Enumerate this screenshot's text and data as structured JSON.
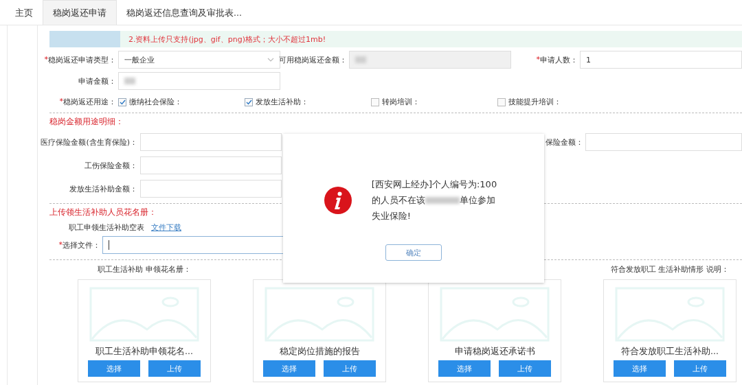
{
  "tabs": [
    {
      "label": "主页",
      "selected": false
    },
    {
      "label": "稳岗返还申请",
      "selected": true
    },
    {
      "label": "稳岗返还信息查询及审批表...",
      "selected": false
    }
  ],
  "notice": "2.资料上传只支持(jpg、gif、png)格式；大小不超过1mb!",
  "application": {
    "type": {
      "mark": "*",
      "label": "稳岗返还申请类型：",
      "value": "一般企业"
    },
    "available": {
      "label": "可用稳岗返还金额：",
      "redacted": true
    },
    "people": {
      "mark": "*",
      "label": "申请人数：",
      "value": "1"
    },
    "amount": {
      "label": "申请金额：",
      "redacted": true
    },
    "purpose": {
      "mark": "*",
      "label": "稳岗返还用途："
    },
    "purposes": [
      {
        "label": "缴纳社会保险：",
        "checked": true
      },
      {
        "label": "发放生活补助：",
        "checked": true
      },
      {
        "label": "转岗培训：",
        "checked": false
      },
      {
        "label": "技能提升培训：",
        "checked": false
      }
    ]
  },
  "detail": {
    "title": "稳岗金额用途明细：",
    "rows": [
      {
        "label": "医疗保险金额(含生育保险)：",
        "right_label": "保险金额："
      },
      {
        "label": "工伤保险金额："
      },
      {
        "label": "发放生活补助金额："
      }
    ]
  },
  "upload": {
    "title": "上传领生活补助人员花名册：",
    "template": "职工申领生活补助空表",
    "link": "文件下载",
    "file": {
      "mark": "*",
      "label": "选择文件："
    }
  },
  "cards": [
    {
      "header": "职工生活补助 申领花名册：",
      "caption": "职工生活补助申领花名...",
      "buttons": [
        "选择",
        "上传"
      ]
    },
    {
      "caption": "稳定岗位措施的报告",
      "buttons": [
        "选择",
        "上传"
      ]
    },
    {
      "caption": "申请稳岗返还承诺书",
      "buttons": [
        "选择",
        "上传"
      ]
    },
    {
      "header": "符合发放职工 生活补助情形 说明：",
      "caption": "符合发放职工生活补助...",
      "buttons": [
        "选择",
        "上传"
      ]
    }
  ],
  "dialog": {
    "line_1": "[西安网上经办]个人编号为:100",
    "line_2_before": "的人员不在该",
    "redacted": true,
    "line_2_after": "单位参加",
    "line_3": "失业保险!",
    "button": "确定"
  }
}
